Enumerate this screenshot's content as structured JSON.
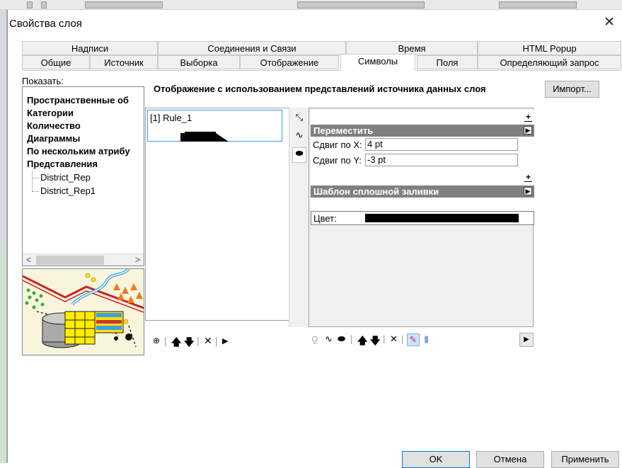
{
  "window": {
    "title": "Свойства слоя"
  },
  "tabs": {
    "row1": [
      "Надписи",
      "Соединения и Связи",
      "Время",
      "HTML Popup"
    ],
    "row2": [
      "Общие",
      "Источник",
      "Выборка",
      "Отображение",
      "Символы",
      "Поля",
      "Определяющий запрос"
    ],
    "active": "Символы"
  },
  "show": {
    "label": "Показать:",
    "items": [
      "Пространственные об",
      "Категории",
      "Количество",
      "Диаграммы",
      "По нескольким атрибу",
      "Представления"
    ],
    "children": [
      "District_Rep",
      "District_Rep1"
    ]
  },
  "main": {
    "heading": "Отображение с использованием представлений источника данных слоя",
    "import_label": "Импорт...",
    "rule_label": "[1] Rule_1"
  },
  "properties": {
    "move": {
      "header": "Переместить",
      "offset_x_label": "Сдвиг по X:",
      "offset_x_value": "4 pt",
      "offset_y_label": "Сдвиг по Y:",
      "offset_y_value": "-3 pt"
    },
    "fill": {
      "header": "Шаблон сплошной заливки",
      "color_label": "Цвет:",
      "color_value": "#000000"
    }
  },
  "buttons": {
    "ok": "OK",
    "cancel": "Отмена",
    "apply": "Применить"
  }
}
